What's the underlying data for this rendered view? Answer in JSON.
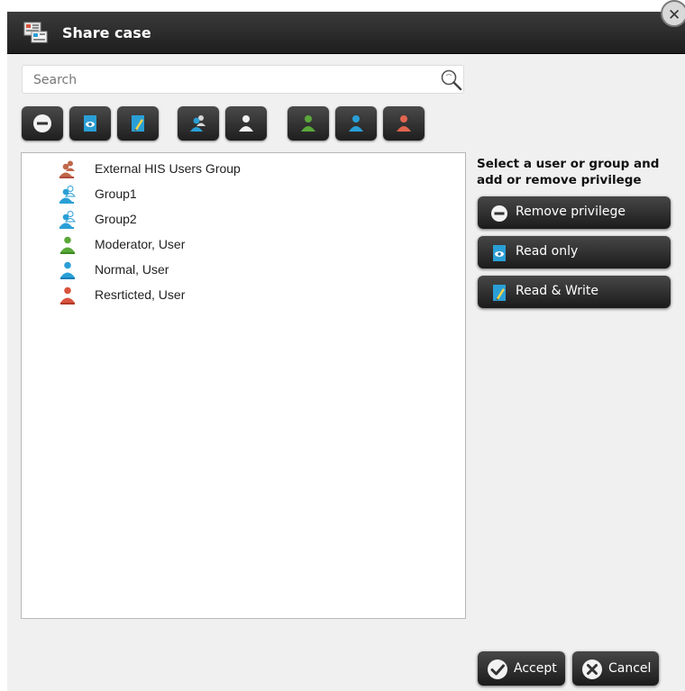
{
  "dialog": {
    "title": "Share case",
    "close_glyph": "✕",
    "icons": {
      "app": "share-case-icon",
      "close": "close-icon"
    }
  },
  "search": {
    "placeholder": "Search",
    "value": "",
    "icon": "magnifier-icon"
  },
  "toolbar": {
    "buttons": [
      {
        "icon": "remove-privilege-icon"
      },
      {
        "icon": "read-only-icon"
      },
      {
        "icon": "read-write-icon"
      },
      {
        "icon": "group-icon"
      },
      {
        "icon": "user-icon"
      },
      {
        "icon": "moderator-user-icon"
      },
      {
        "icon": "normal-user-icon"
      },
      {
        "icon": "restricted-user-icon"
      }
    ]
  },
  "list": {
    "items": [
      {
        "label": "External HIS Users Group",
        "icon": "external-group-icon",
        "color": "#c0674a"
      },
      {
        "label": "Group1",
        "icon": "group-icon",
        "color": "#2a9fd6"
      },
      {
        "label": "Group2",
        "icon": "group-icon",
        "color": "#2a9fd6"
      },
      {
        "label": "Moderator, User",
        "icon": "moderator-user-icon",
        "color": "#5aa83a"
      },
      {
        "label": "Normal, User",
        "icon": "normal-user-icon",
        "color": "#2a9fd6"
      },
      {
        "label": "Resrticted, User",
        "icon": "restricted-user-icon",
        "color": "#d9533f"
      }
    ]
  },
  "side_panel": {
    "instruction": "Select a user or group and add or remove privilege",
    "buttons": {
      "remove": {
        "label": "Remove privilege",
        "icon": "remove-privilege-icon"
      },
      "read_only": {
        "label": "Read only",
        "icon": "read-only-icon"
      },
      "read_write": {
        "label": "Read & Write",
        "icon": "read-write-icon"
      }
    }
  },
  "footer": {
    "accept": {
      "label": "Accept",
      "icon": "check-icon"
    },
    "cancel": {
      "label": "Cancel",
      "icon": "cancel-icon"
    }
  },
  "colors": {
    "title_bar": "#2a2a2a",
    "dialog_bg": "#f0f0f0",
    "blue": "#2a9fd6",
    "green": "#5aa83a",
    "red": "#d9533f",
    "brown": "#c0674a"
  }
}
